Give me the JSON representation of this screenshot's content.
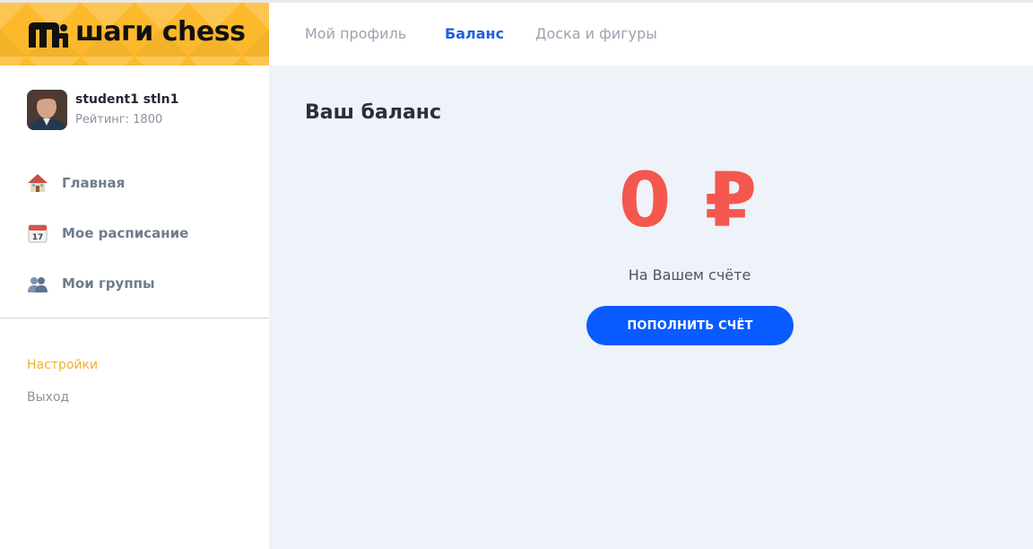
{
  "brand": {
    "name": "шаги chess",
    "color": "#fcb92c"
  },
  "user": {
    "name": "student1 stln1",
    "rating": "Рейтинг: 1800"
  },
  "sidebar": {
    "items": [
      {
        "label": "Главная",
        "icon": "house-icon"
      },
      {
        "label": "Мое расписание",
        "icon": "calendar-icon"
      },
      {
        "label": "Мои группы",
        "icon": "people-icon"
      }
    ],
    "settings_label": "Настройки",
    "logout_label": "Выход"
  },
  "tabs": [
    {
      "label": "Мой профиль",
      "active": false
    },
    {
      "label": "Баланс",
      "active": true
    },
    {
      "label": "Доска и фигуры",
      "active": false
    }
  ],
  "balance": {
    "title": "Ваш баланс",
    "amount": "0 ₽",
    "subtitle": "На Вашем счёте",
    "topup_label": "ПОПОЛНИТЬ СЧЁТ"
  },
  "colors": {
    "accent_blue": "#0a5bff",
    "amount_red": "#f4574e",
    "settings_orange": "#f0b02a",
    "main_bg": "#eef2f9"
  }
}
